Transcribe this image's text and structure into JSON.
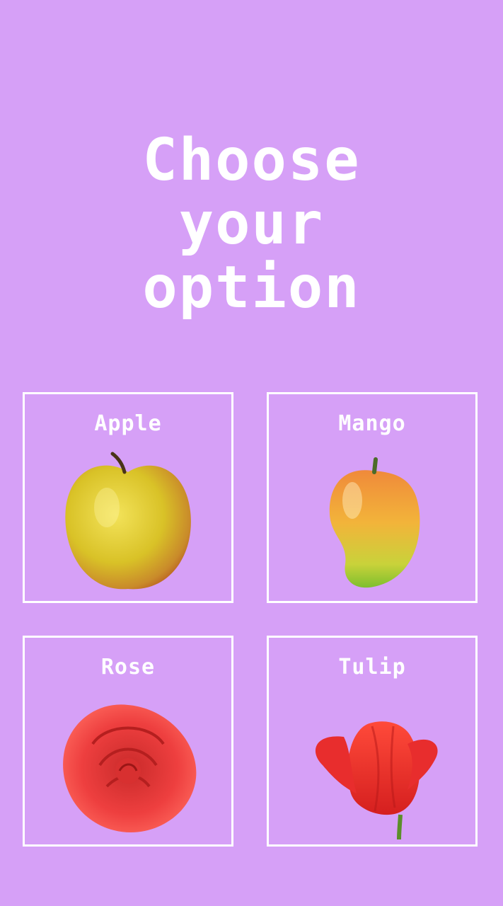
{
  "title": {
    "line1": "Choose",
    "line2": "your",
    "line3": "option"
  },
  "options": [
    {
      "label": "Apple",
      "icon": "apple-icon"
    },
    {
      "label": "Mango",
      "icon": "mango-icon"
    },
    {
      "label": "Rose",
      "icon": "rose-icon"
    },
    {
      "label": "Tulip",
      "icon": "tulip-icon"
    }
  ],
  "colors": {
    "background": "#d6a0f7",
    "border": "#ffffff",
    "text": "#ffffff"
  }
}
